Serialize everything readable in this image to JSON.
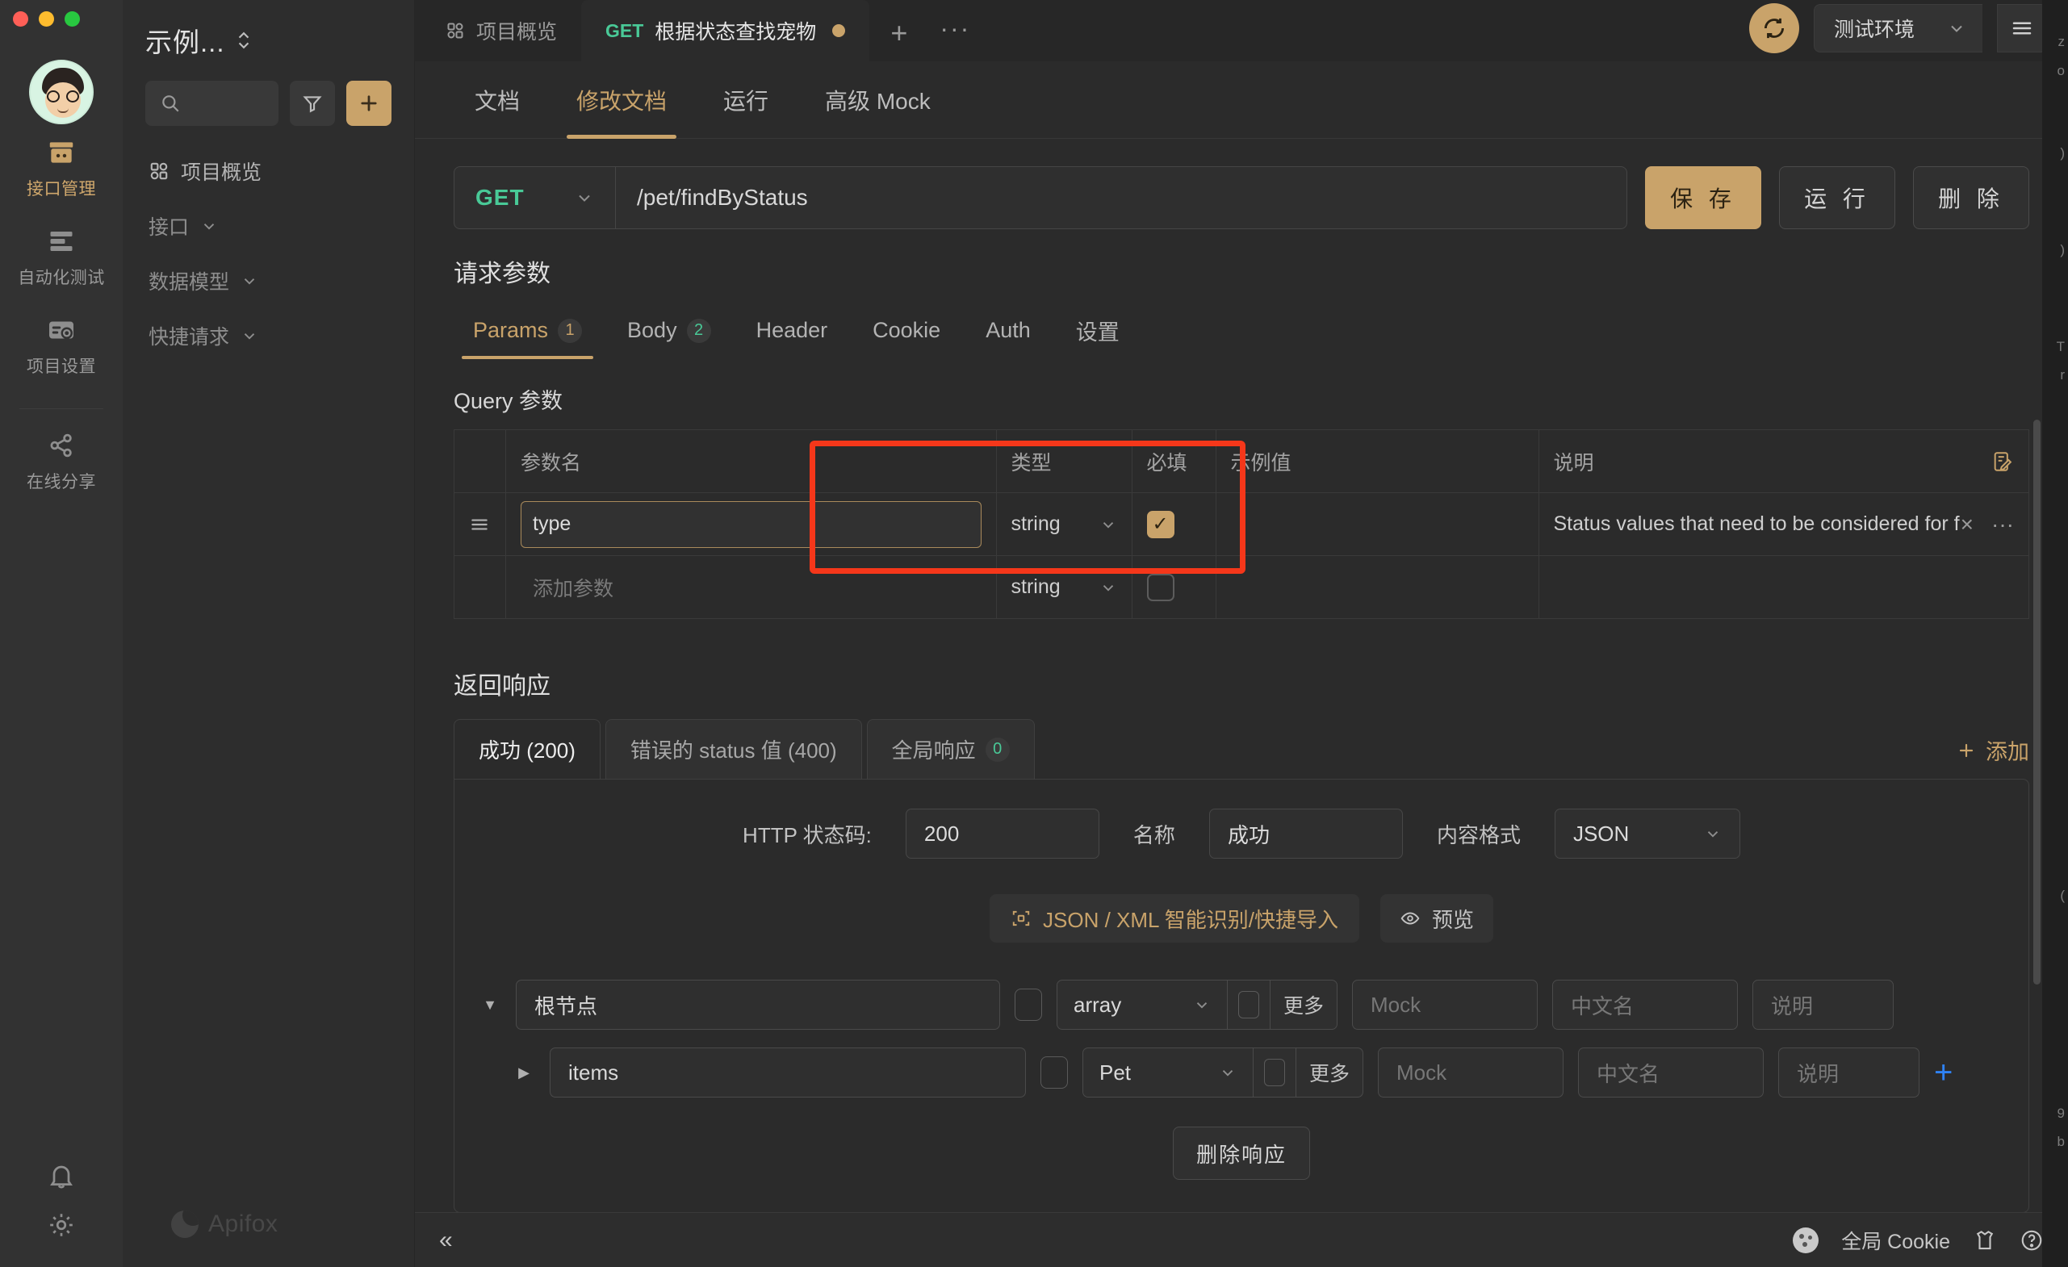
{
  "window": {
    "traffic_lights": [
      "close",
      "minimize",
      "maximize"
    ]
  },
  "rail": {
    "items": [
      {
        "label": "接口管理",
        "icon": "api-box-icon",
        "active": true
      },
      {
        "label": "自动化测试",
        "icon": "automation-icon",
        "active": false
      },
      {
        "label": "项目设置",
        "icon": "project-settings-icon",
        "active": false
      },
      {
        "label": "在线分享",
        "icon": "share-icon",
        "active": false
      }
    ],
    "bottom_icons": [
      {
        "name": "bell-icon"
      },
      {
        "name": "gear-icon"
      }
    ]
  },
  "sidebar": {
    "project_title": "示例...",
    "search_placeholder": "",
    "filter_label": "",
    "add_label": "+",
    "items": [
      {
        "label": "项目概览",
        "icon": "grid-icon",
        "type": "link"
      },
      {
        "label": "接口",
        "icon": "chevron-down-icon",
        "type": "group"
      },
      {
        "label": "数据模型",
        "icon": "chevron-down-icon",
        "type": "group"
      },
      {
        "label": "快捷请求",
        "icon": "chevron-down-icon",
        "type": "group"
      }
    ],
    "brand": "Apifox"
  },
  "tabbar": {
    "tabs": [
      {
        "label": "项目概览",
        "method": "",
        "active": false,
        "dirty": false,
        "icon": "grid-icon"
      },
      {
        "label": "根据状态查找宠物",
        "method": "GET",
        "active": true,
        "dirty": true,
        "icon": ""
      }
    ],
    "add_tab": "+",
    "more_tabs": "···",
    "sync_icon": "sync-icon",
    "environment": "测试环境",
    "menu_icon": "hamburger-icon"
  },
  "subtabs": [
    {
      "label": "文档",
      "active": false
    },
    {
      "label": "修改文档",
      "active": true
    },
    {
      "label": "运行",
      "active": false
    },
    {
      "label": "高级 Mock",
      "active": false
    }
  ],
  "url_row": {
    "method": "GET",
    "path": "/pet/findByStatus",
    "save_label": "保 存",
    "run_label": "运 行",
    "delete_label": "删 除"
  },
  "request": {
    "section_title": "请求参数",
    "tabs": [
      {
        "label": "Params",
        "count": "1",
        "active": true,
        "count_color": "amber"
      },
      {
        "label": "Body",
        "count": "2",
        "active": false,
        "count_color": "green"
      },
      {
        "label": "Header",
        "count": "",
        "active": false
      },
      {
        "label": "Cookie",
        "count": "",
        "active": false
      },
      {
        "label": "Auth",
        "count": "",
        "active": false
      },
      {
        "label": "设置",
        "count": "",
        "active": false
      }
    ],
    "query_title": "Query 参数",
    "columns": [
      "",
      "参数名",
      "类型",
      "必填",
      "示例值",
      "说明"
    ],
    "header_action_icon": "bulk-edit-icon",
    "rows": [
      {
        "handle": "drag-handle-icon",
        "name": "type",
        "name_placeholder": "参数名",
        "focused": true,
        "type": "string",
        "required": true,
        "example": "",
        "description": "Status values that need to be considered for fil",
        "actions": [
          "×",
          "···"
        ]
      },
      {
        "handle": "",
        "name": "",
        "name_placeholder": "添加参数",
        "focused": false,
        "type": "string",
        "required": false,
        "example": "",
        "description": "",
        "actions": []
      }
    ]
  },
  "response": {
    "section_title": "返回响应",
    "tabs": [
      {
        "label": "成功 (200)",
        "count": "",
        "active": true
      },
      {
        "label": "错误的 status 值 (400)",
        "count": "",
        "active": false
      },
      {
        "label": "全局响应",
        "count": "0",
        "active": false
      }
    ],
    "add_label": "添加",
    "status_code_label": "HTTP 状态码:",
    "status_code_value": "200",
    "name_label": "名称",
    "name_value": "成功",
    "format_label": "内容格式",
    "format_value": "JSON",
    "import_label": "JSON / XML 智能识别/快捷导入",
    "preview_label": "预览",
    "schema_rows": [
      {
        "caret": "expanded",
        "indent": 0,
        "name": "根节点",
        "type": "array",
        "more_label": "更多",
        "mock_placeholder": "Mock",
        "cn_placeholder": "中文名",
        "desc_placeholder": "说明",
        "show_plus": false
      },
      {
        "caret": "collapsed",
        "indent": 1,
        "name": "items",
        "type": "Pet",
        "more_label": "更多",
        "mock_placeholder": "Mock",
        "cn_placeholder": "中文名",
        "desc_placeholder": "说明",
        "show_plus": true
      }
    ],
    "delete_label": "删除响应"
  },
  "bottombar": {
    "collapse_icon": "collapse-left-icon",
    "cookie_label": "全局 Cookie",
    "icons": [
      {
        "name": "shirt-icon"
      },
      {
        "name": "help-circle-icon"
      }
    ]
  },
  "colors": {
    "accent": "#c9a36a",
    "method_get": "#49c997",
    "highlight_box": "#f5371a",
    "plus_blue": "#2f82f5",
    "bg_main": "#2b2b2b",
    "bg_side": "#2d2d2d",
    "bg_rail": "#323232"
  }
}
